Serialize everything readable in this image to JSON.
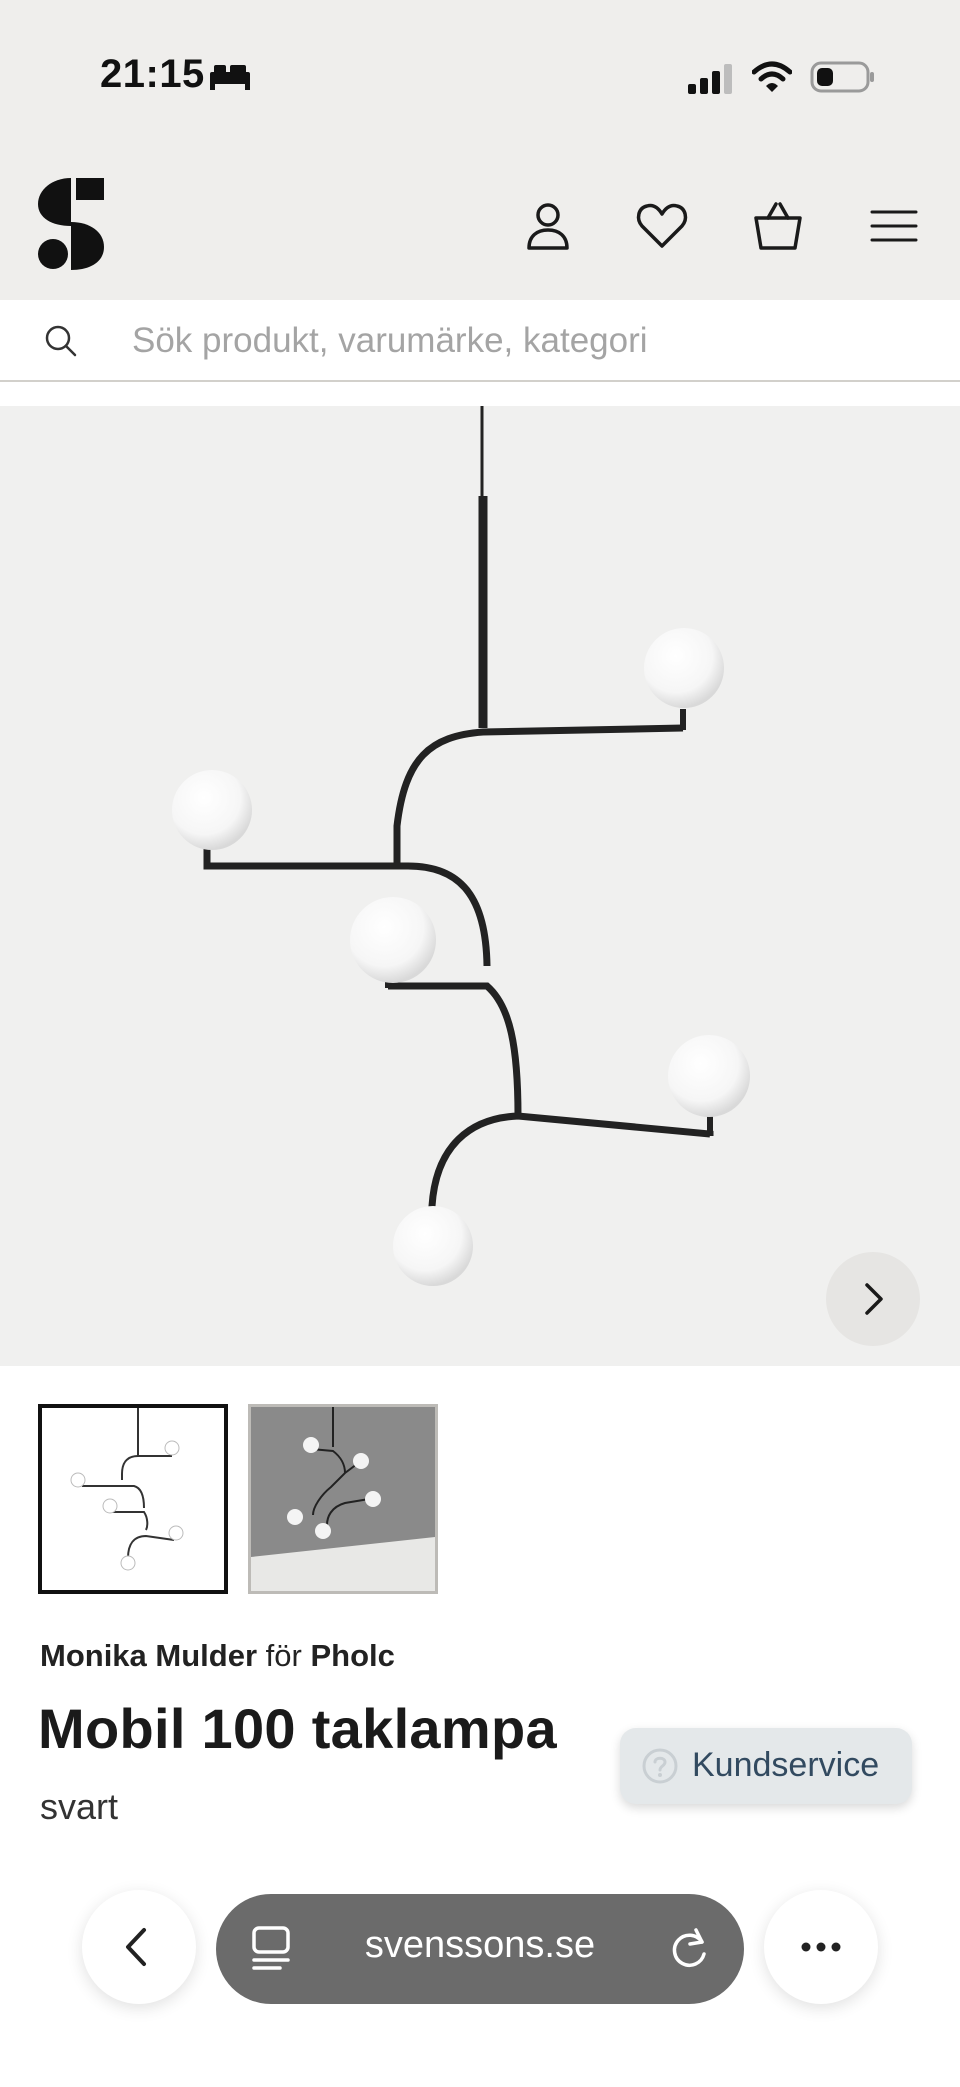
{
  "status_bar": {
    "time": "21:15",
    "icons": [
      "sleep-focus-icon",
      "cellular-signal-icon",
      "wifi-icon",
      "battery-icon"
    ]
  },
  "header": {
    "logo": "svenssons-logo",
    "icons": [
      "account-icon",
      "heart-icon",
      "shopping-bag-icon",
      "hamburger-menu-icon"
    ]
  },
  "search": {
    "placeholder": "Sök produkt, varumärke, kategori",
    "value": ""
  },
  "gallery": {
    "next_icon": "chevron-right-icon",
    "selected_thumbnail": 1,
    "thumbnail_count": 2
  },
  "product": {
    "designer": "Monika Mulder",
    "for_word": "för",
    "brand": "Pholc",
    "title": "Mobil 100 taklampa",
    "variant": "svart"
  },
  "support": {
    "label": "Kundservice",
    "icon": "help-circle-icon"
  },
  "browser": {
    "url": "svenssons.se",
    "icons": [
      "back-chevron-icon",
      "tabs-icon",
      "reload-icon",
      "more-dots-icon"
    ]
  },
  "colors": {
    "header_bg": "#efeeec",
    "hero_bg": "#f0f0ef",
    "kundservice_bg": "#e4e8ea",
    "kundservice_text": "#324a60",
    "url_pill_bg": "#6b6b6b"
  }
}
